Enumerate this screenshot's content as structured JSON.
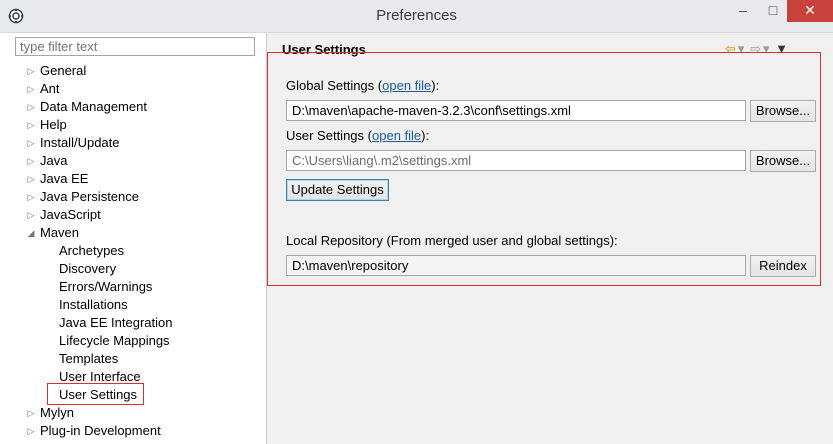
{
  "window": {
    "title": "Preferences",
    "minimize": "–",
    "maximize": "□",
    "close": "✕"
  },
  "filter": {
    "placeholder": "type filter text"
  },
  "tree": {
    "top_before": [
      "General",
      "Ant",
      "Data Management",
      "Help",
      "Install/Update",
      "Java",
      "Java EE",
      "Java Persistence",
      "JavaScript"
    ],
    "maven": "Maven",
    "maven_children": [
      "Archetypes",
      "Discovery",
      "Errors/Warnings",
      "Installations",
      "Java EE Integration",
      "Lifecycle Mappings",
      "Templates",
      "User Interface",
      "User Settings"
    ],
    "top_after": [
      "Mylyn",
      "Plug-in Development"
    ],
    "selected": "User Settings"
  },
  "page": {
    "title": "User Settings",
    "global_label": "Global Settings",
    "global_open_file": "open file",
    "global_value": "D:\\maven\\apache-maven-3.2.3\\conf\\settings.xml",
    "user_label": "User Settings",
    "user_open_file": "open file",
    "user_value": "C:\\Users\\liang\\.m2\\settings.xml",
    "browse": "Browse...",
    "update": "Update Settings",
    "local_label": "Local Repository (From merged user and global settings):",
    "local_value": "D:\\maven\\repository",
    "reindex": "Reindex"
  }
}
